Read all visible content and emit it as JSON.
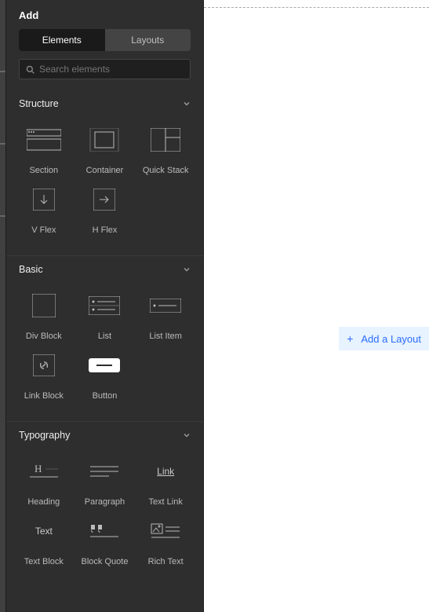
{
  "panel": {
    "title": "Add",
    "tabs": {
      "elements": "Elements",
      "layouts": "Layouts"
    },
    "search": {
      "placeholder": "Search elements"
    }
  },
  "sections": {
    "structure": {
      "title": "Structure",
      "items": [
        {
          "label": "Section"
        },
        {
          "label": "Container"
        },
        {
          "label": "Quick Stack"
        },
        {
          "label": "V Flex"
        },
        {
          "label": "H Flex"
        }
      ]
    },
    "basic": {
      "title": "Basic",
      "items": [
        {
          "label": "Div Block"
        },
        {
          "label": "List"
        },
        {
          "label": "List Item"
        },
        {
          "label": "Link Block"
        },
        {
          "label": "Button"
        }
      ]
    },
    "typography": {
      "title": "Typography",
      "items": [
        {
          "label": "Heading"
        },
        {
          "label": "Paragraph"
        },
        {
          "label": "Text Link",
          "icon_text": "Link"
        },
        {
          "label": "Text Block",
          "icon_text": "Text"
        },
        {
          "label": "Block Quote"
        },
        {
          "label": "Rich Text"
        }
      ]
    }
  },
  "canvas": {
    "add_layout": "Add a Layout"
  }
}
